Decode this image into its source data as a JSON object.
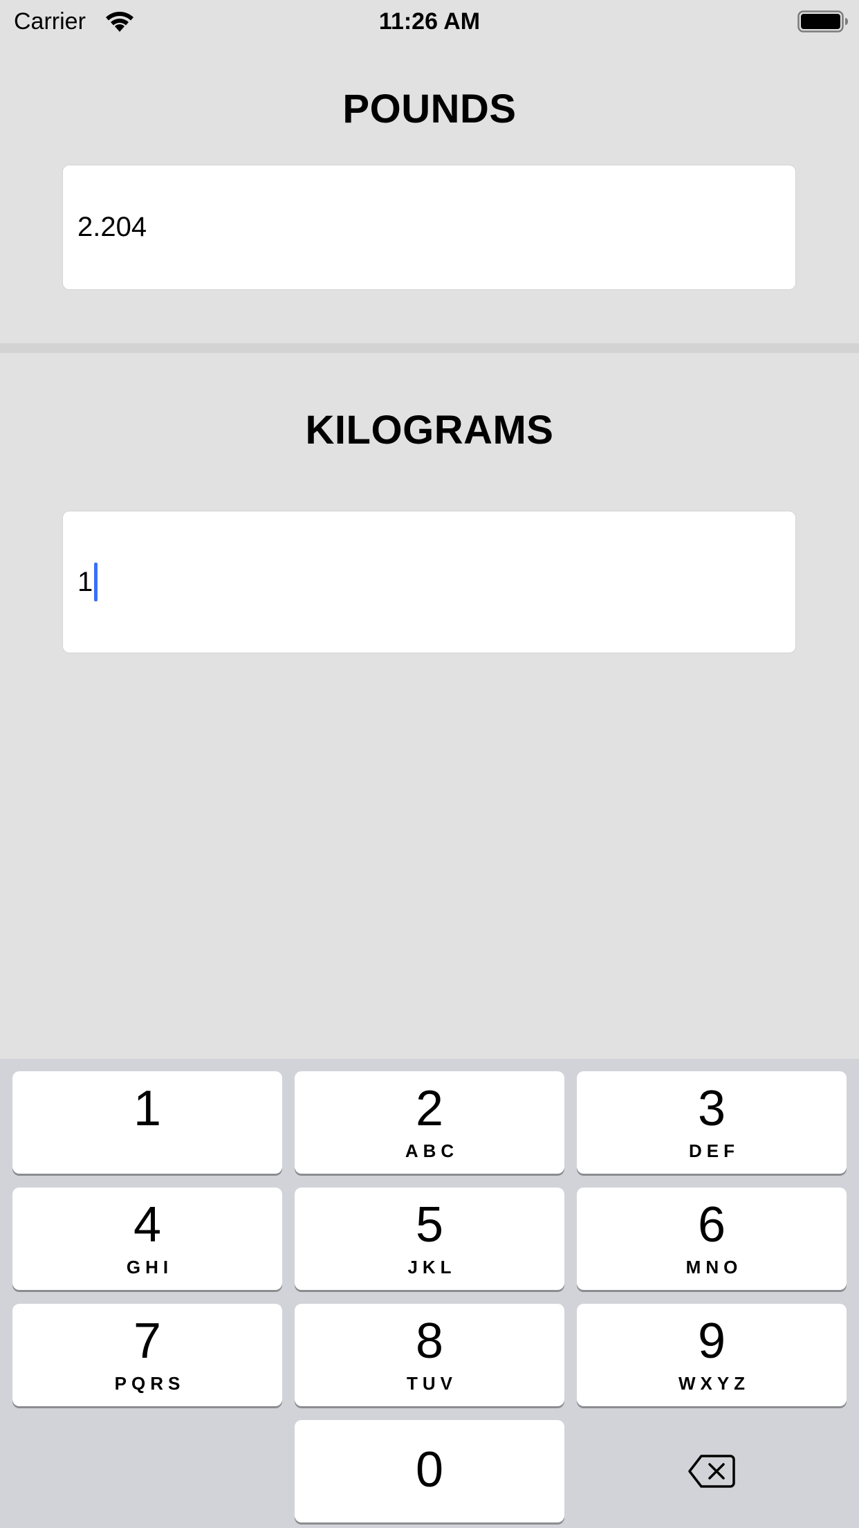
{
  "status_bar": {
    "carrier": "Carrier",
    "time": "11:26 AM",
    "wifi_icon": "wifi-icon",
    "battery_icon": "battery-icon"
  },
  "pounds": {
    "title": "POUNDS",
    "value": "2.204"
  },
  "kilograms": {
    "title": "KILOGRAMS",
    "value": "1"
  },
  "keypad": {
    "keys": [
      {
        "digit": "1",
        "letters": ""
      },
      {
        "digit": "2",
        "letters": "ABC"
      },
      {
        "digit": "3",
        "letters": "DEF"
      },
      {
        "digit": "4",
        "letters": "GHI"
      },
      {
        "digit": "5",
        "letters": "JKL"
      },
      {
        "digit": "6",
        "letters": "MNO"
      },
      {
        "digit": "7",
        "letters": "PQRS"
      },
      {
        "digit": "8",
        "letters": "TUV"
      },
      {
        "digit": "9",
        "letters": "WXYZ"
      },
      {
        "digit": "0",
        "letters": ""
      }
    ],
    "delete_icon": "backspace-icon"
  },
  "colors": {
    "background": "#e1e1e2",
    "caret": "#3a6ff7",
    "keyboard_background": "#d2d3d8"
  }
}
